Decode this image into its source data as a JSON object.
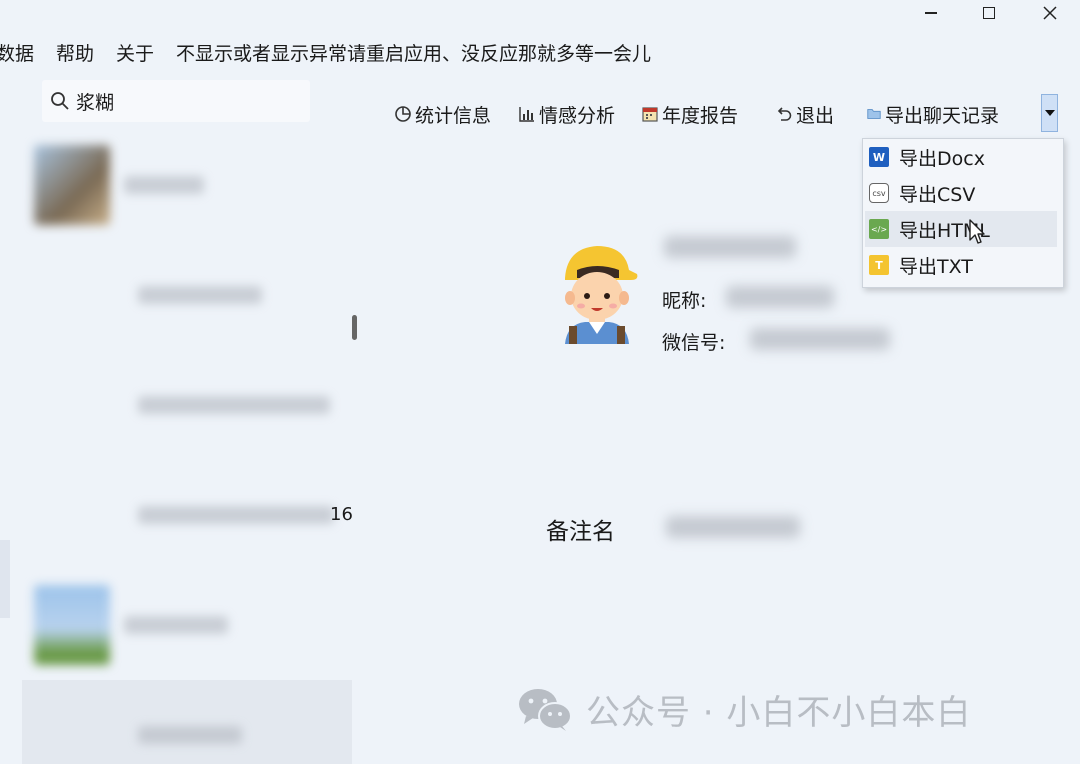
{
  "window": {
    "minimize_icon": "minimize-icon",
    "maximize_icon": "maximize-icon",
    "close_icon": "close-icon"
  },
  "menu": {
    "items": [
      "数据",
      "帮助",
      "关于"
    ],
    "notice": "不显示或者显示异常请重启应用、没反应那就多等一会儿"
  },
  "search": {
    "value": "浆糊",
    "icon": "search-icon"
  },
  "contacts": {
    "items": [
      {
        "name": "",
        "has_avatar": true
      },
      {
        "name": "",
        "has_avatar": false
      },
      {
        "name": "",
        "has_avatar": false
      },
      {
        "name": "",
        "has_avatar": false,
        "suffix": "16"
      },
      {
        "name": "",
        "has_avatar": true
      },
      {
        "name": "",
        "has_avatar": false,
        "selected": true
      }
    ]
  },
  "toolbar": {
    "stats_label": "统计信息",
    "sentiment_label": "情感分析",
    "annual_label": "年度报告",
    "exit_label": "退出",
    "export_label": "导出聊天记录"
  },
  "export_menu": {
    "items": [
      {
        "label": "导出Docx",
        "icon": "word-icon",
        "icon_text": "W"
      },
      {
        "label": "导出CSV",
        "icon": "csv-icon",
        "icon_text": "csv"
      },
      {
        "label": "导出HTML",
        "icon": "html-icon",
        "icon_text": "</>"
      },
      {
        "label": "导出TXT",
        "icon": "txt-icon",
        "icon_text": "T"
      }
    ],
    "hovered_index": 2
  },
  "profile": {
    "nickname_label": "昵称:",
    "wechat_id_label": "微信号:",
    "remark_label": "备注名"
  },
  "watermark": {
    "text": "公众号 · 小白不小白本白",
    "icon": "wechat-logo-icon"
  },
  "colors": {
    "background": "#eef3f9",
    "accent": "#1f5fbf",
    "watermark": "#b8bdc4"
  }
}
